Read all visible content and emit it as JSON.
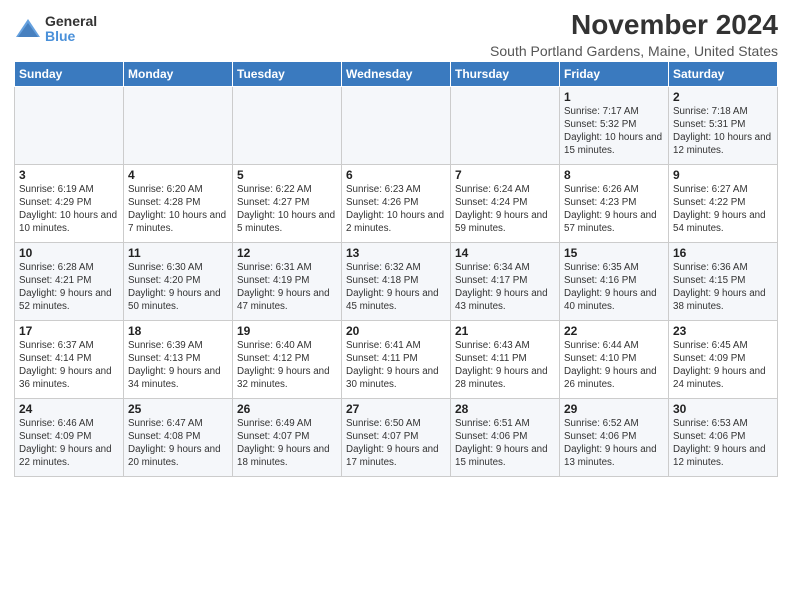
{
  "logo": {
    "general": "General",
    "blue": "Blue"
  },
  "title": "November 2024",
  "subtitle": "South Portland Gardens, Maine, United States",
  "days_header": [
    "Sunday",
    "Monday",
    "Tuesday",
    "Wednesday",
    "Thursday",
    "Friday",
    "Saturday"
  ],
  "weeks": [
    [
      {
        "day": "",
        "info": ""
      },
      {
        "day": "",
        "info": ""
      },
      {
        "day": "",
        "info": ""
      },
      {
        "day": "",
        "info": ""
      },
      {
        "day": "",
        "info": ""
      },
      {
        "day": "1",
        "info": "Sunrise: 7:17 AM\nSunset: 5:32 PM\nDaylight: 10 hours and 15 minutes."
      },
      {
        "day": "2",
        "info": "Sunrise: 7:18 AM\nSunset: 5:31 PM\nDaylight: 10 hours and 12 minutes."
      }
    ],
    [
      {
        "day": "3",
        "info": "Sunrise: 6:19 AM\nSunset: 4:29 PM\nDaylight: 10 hours and 10 minutes."
      },
      {
        "day": "4",
        "info": "Sunrise: 6:20 AM\nSunset: 4:28 PM\nDaylight: 10 hours and 7 minutes."
      },
      {
        "day": "5",
        "info": "Sunrise: 6:22 AM\nSunset: 4:27 PM\nDaylight: 10 hours and 5 minutes."
      },
      {
        "day": "6",
        "info": "Sunrise: 6:23 AM\nSunset: 4:26 PM\nDaylight: 10 hours and 2 minutes."
      },
      {
        "day": "7",
        "info": "Sunrise: 6:24 AM\nSunset: 4:24 PM\nDaylight: 9 hours and 59 minutes."
      },
      {
        "day": "8",
        "info": "Sunrise: 6:26 AM\nSunset: 4:23 PM\nDaylight: 9 hours and 57 minutes."
      },
      {
        "day": "9",
        "info": "Sunrise: 6:27 AM\nSunset: 4:22 PM\nDaylight: 9 hours and 54 minutes."
      }
    ],
    [
      {
        "day": "10",
        "info": "Sunrise: 6:28 AM\nSunset: 4:21 PM\nDaylight: 9 hours and 52 minutes."
      },
      {
        "day": "11",
        "info": "Sunrise: 6:30 AM\nSunset: 4:20 PM\nDaylight: 9 hours and 50 minutes."
      },
      {
        "day": "12",
        "info": "Sunrise: 6:31 AM\nSunset: 4:19 PM\nDaylight: 9 hours and 47 minutes."
      },
      {
        "day": "13",
        "info": "Sunrise: 6:32 AM\nSunset: 4:18 PM\nDaylight: 9 hours and 45 minutes."
      },
      {
        "day": "14",
        "info": "Sunrise: 6:34 AM\nSunset: 4:17 PM\nDaylight: 9 hours and 43 minutes."
      },
      {
        "day": "15",
        "info": "Sunrise: 6:35 AM\nSunset: 4:16 PM\nDaylight: 9 hours and 40 minutes."
      },
      {
        "day": "16",
        "info": "Sunrise: 6:36 AM\nSunset: 4:15 PM\nDaylight: 9 hours and 38 minutes."
      }
    ],
    [
      {
        "day": "17",
        "info": "Sunrise: 6:37 AM\nSunset: 4:14 PM\nDaylight: 9 hours and 36 minutes."
      },
      {
        "day": "18",
        "info": "Sunrise: 6:39 AM\nSunset: 4:13 PM\nDaylight: 9 hours and 34 minutes."
      },
      {
        "day": "19",
        "info": "Sunrise: 6:40 AM\nSunset: 4:12 PM\nDaylight: 9 hours and 32 minutes."
      },
      {
        "day": "20",
        "info": "Sunrise: 6:41 AM\nSunset: 4:11 PM\nDaylight: 9 hours and 30 minutes."
      },
      {
        "day": "21",
        "info": "Sunrise: 6:43 AM\nSunset: 4:11 PM\nDaylight: 9 hours and 28 minutes."
      },
      {
        "day": "22",
        "info": "Sunrise: 6:44 AM\nSunset: 4:10 PM\nDaylight: 9 hours and 26 minutes."
      },
      {
        "day": "23",
        "info": "Sunrise: 6:45 AM\nSunset: 4:09 PM\nDaylight: 9 hours and 24 minutes."
      }
    ],
    [
      {
        "day": "24",
        "info": "Sunrise: 6:46 AM\nSunset: 4:09 PM\nDaylight: 9 hours and 22 minutes."
      },
      {
        "day": "25",
        "info": "Sunrise: 6:47 AM\nSunset: 4:08 PM\nDaylight: 9 hours and 20 minutes."
      },
      {
        "day": "26",
        "info": "Sunrise: 6:49 AM\nSunset: 4:07 PM\nDaylight: 9 hours and 18 minutes."
      },
      {
        "day": "27",
        "info": "Sunrise: 6:50 AM\nSunset: 4:07 PM\nDaylight: 9 hours and 17 minutes."
      },
      {
        "day": "28",
        "info": "Sunrise: 6:51 AM\nSunset: 4:06 PM\nDaylight: 9 hours and 15 minutes."
      },
      {
        "day": "29",
        "info": "Sunrise: 6:52 AM\nSunset: 4:06 PM\nDaylight: 9 hours and 13 minutes."
      },
      {
        "day": "30",
        "info": "Sunrise: 6:53 AM\nSunset: 4:06 PM\nDaylight: 9 hours and 12 minutes."
      }
    ]
  ]
}
